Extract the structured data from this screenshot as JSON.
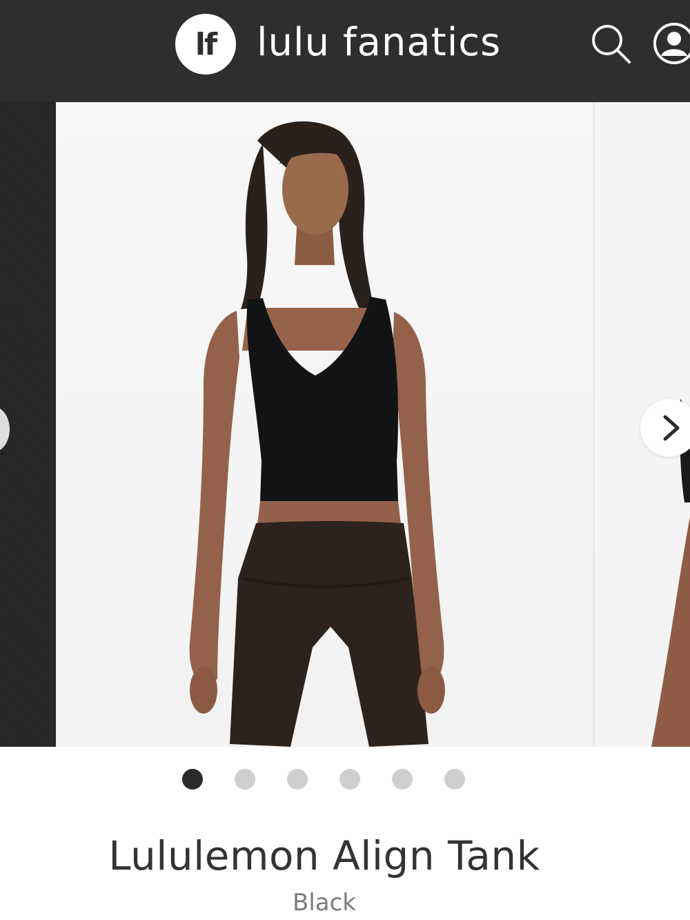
{
  "header": {
    "logo_text": "lf",
    "brand_name": "lulu fanatics",
    "search_icon": "search-icon",
    "account_icon": "user-account-icon",
    "background_color": "#2e2e2e"
  },
  "carousel": {
    "prev_icon": "chevron-left-icon",
    "next_icon": "chevron-right-icon",
    "image_description_icon": "product-photo",
    "slide_count": 6,
    "active_index": 0
  },
  "product": {
    "title": "Lululemon Align Tank",
    "color": "Black"
  },
  "colors": {
    "active_dot": "#2b2b2b",
    "inactive_dot": "#cfcfcf",
    "title_text": "#333333",
    "subtitle_text": "#7a7a7a"
  }
}
